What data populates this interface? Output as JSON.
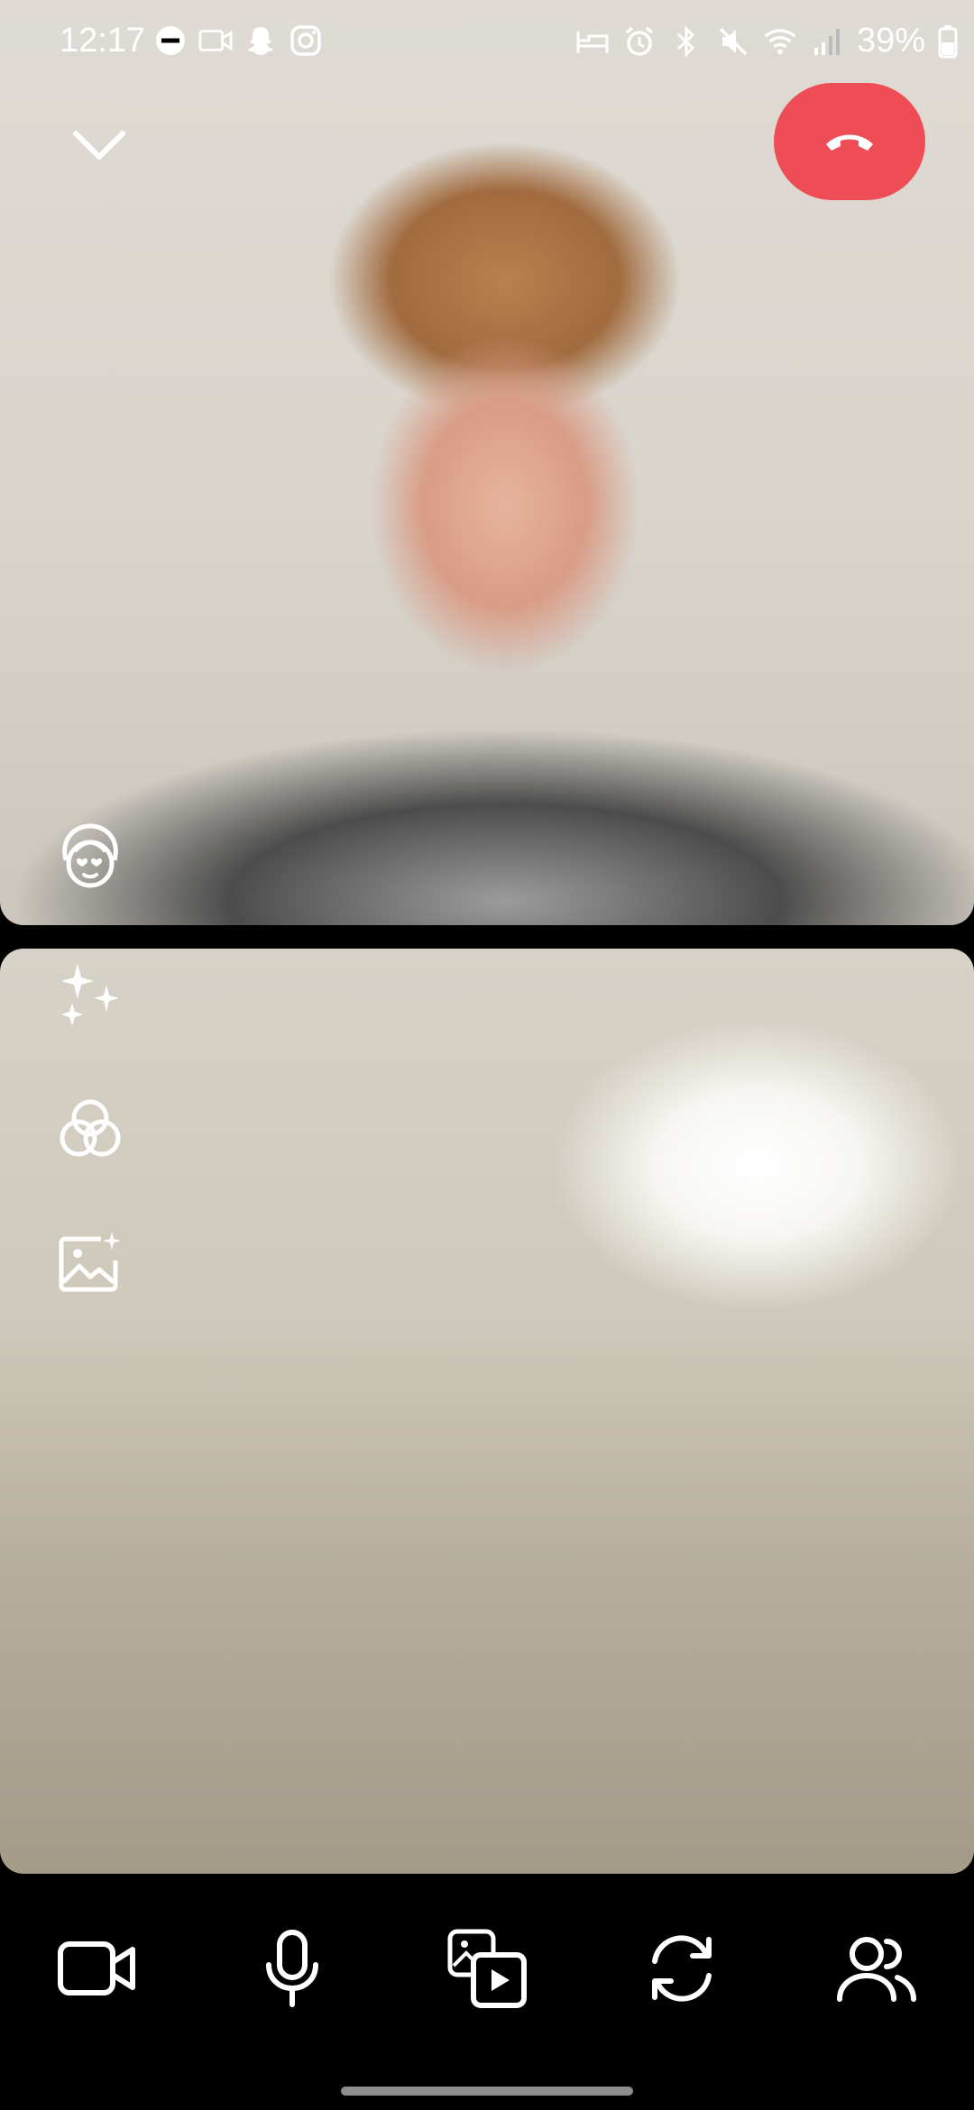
{
  "status_bar": {
    "time": "12:17",
    "battery": "39%",
    "left_icons": [
      "do-not-disturb-icon",
      "video-icon",
      "snapchat-icon",
      "instagram-icon"
    ],
    "right_icons": [
      "bed-icon",
      "alarm-icon",
      "bluetooth-icon",
      "mute-icon",
      "wifi-icon",
      "signal-icon",
      "battery-icon"
    ]
  },
  "call": {
    "collapse_icon": "chevron-down-icon",
    "end_call_icon": "hang-up-icon",
    "end_call_color": "#ef4d55"
  },
  "effects": [
    "face-filter-icon",
    "sparkles-icon",
    "color-filter-icon",
    "ai-image-icon"
  ],
  "toolbar": {
    "buttons": [
      "camera-icon",
      "microphone-icon",
      "media-share-icon",
      "flip-camera-icon",
      "participants-icon"
    ]
  }
}
